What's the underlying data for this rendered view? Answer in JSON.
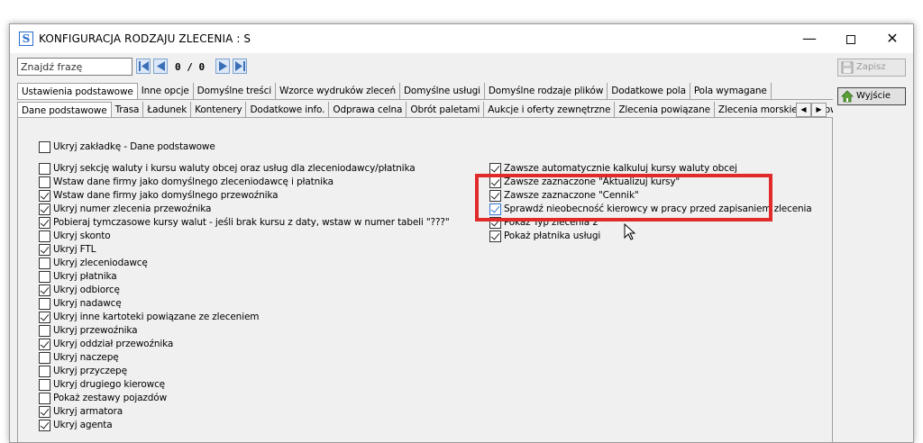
{
  "window": {
    "title": "KONFIGURACJA RODZAJU ZLECENIA : S",
    "app_icon_letter": "S",
    "min_glyph": "—",
    "close_glyph": "✕"
  },
  "search": {
    "placeholder": "Znajdź frazę",
    "value": "Znajdź frazę",
    "counter": "0 / 0"
  },
  "toolbar": {
    "save_label": "Zapisz",
    "exit_label": "Wyjście"
  },
  "tabs_main": [
    "Ustawienia podstawowe",
    "Inne opcje",
    "Domyślne treści",
    "Wzorce wydruków zleceń",
    "Domyślne usługi",
    "Domyślne rodzaje plików",
    "Dodatkowe pola",
    "Pola wymagane"
  ],
  "tabs_sub": [
    "Dane podstawowe",
    "Trasa",
    "Ładunek",
    "Kontenery",
    "Dodatkowe info.",
    "Odprawa celna",
    "Obrót paletami",
    "Aukcje i oferty zewnętrzne",
    "Zlecenia powiązane",
    "Zlecenia morskie/promow"
  ],
  "tab_scroll": {
    "left": "◀",
    "right": "▶"
  },
  "left_options": [
    {
      "label": "Ukryj zakładkę - Dane podstawowe",
      "checked": false
    },
    {
      "label": "Ukryj sekcję waluty i kursu waluty obcej oraz usług dla zleceniodawcy/płatnika",
      "checked": false
    },
    {
      "label": "Wstaw dane firmy jako domyślnego zleceniodawcę i płatnika",
      "checked": false
    },
    {
      "label": "Wstaw dane firmy jako domyślnego przewoźnika",
      "checked": true
    },
    {
      "label": "Ukryj numer zlecenia przewoźnika",
      "checked": true
    },
    {
      "label": "Pobieraj tymczasowe kursy walut - jeśli brak kursu z daty, wstaw w numer tabeli \"???\"",
      "checked": true
    },
    {
      "label": "Ukryj skonto",
      "checked": false
    },
    {
      "label": "Ukryj FTL",
      "checked": true
    },
    {
      "label": "Ukryj zleceniodawcę",
      "checked": false
    },
    {
      "label": "Ukryj płatnika",
      "checked": false
    },
    {
      "label": "Ukryj odbiorcę",
      "checked": true
    },
    {
      "label": "Ukryj nadawcę",
      "checked": false
    },
    {
      "label": "Ukryj inne kartoteki powiązane ze zleceniem",
      "checked": true
    },
    {
      "label": "Ukryj przewoźnika",
      "checked": false
    },
    {
      "label": "Ukryj oddział przewoźnika",
      "checked": true
    },
    {
      "label": "Ukryj naczepę",
      "checked": false
    },
    {
      "label": "Ukryj przyczepę",
      "checked": false
    },
    {
      "label": "Ukryj drugiego kierowcę",
      "checked": false
    },
    {
      "label": "Pokaż zestawy pojazdów",
      "checked": false
    },
    {
      "label": "Ukryj armatora",
      "checked": true
    },
    {
      "label": "Ukryj agenta",
      "checked": true
    }
  ],
  "right_options": [
    {
      "label": "Zawsze automatycznie kalkuluj kursy waluty obcej",
      "checked": true
    },
    {
      "label": "Zawsze zaznaczone \"Aktualizuj kursy\"",
      "checked": true
    },
    {
      "label": "Zawsze zaznaczone \"Cennik\"",
      "checked": true
    },
    {
      "label": "Sprawdź nieobecność kierowcy w pracy przed zapisaniem zlecenia",
      "checked": true
    },
    {
      "label": "Pokaż Typ zlecenia 2",
      "checked": true
    },
    {
      "label": "Pokaż płatnika usługi",
      "checked": true
    }
  ],
  "colors": {
    "highlight": "#e12a2a",
    "window_bg": "#f0f0f0",
    "accent": "#2a6fcf"
  }
}
